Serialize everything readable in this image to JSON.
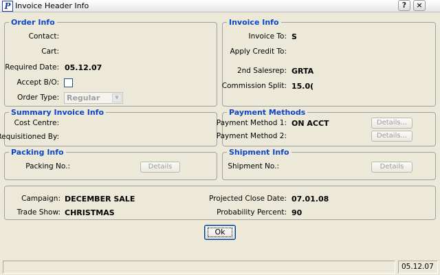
{
  "window": {
    "title": "Invoice Header Info",
    "icon_letter": "P",
    "help_glyph": "?",
    "close_glyph": "×"
  },
  "order_info": {
    "legend": "Order Info",
    "contact_label": "Contact:",
    "contact_value": "",
    "cart_label": "Cart:",
    "cart_value": "",
    "required_date_label": "Required Date:",
    "required_date_value": "05.12.07",
    "accept_bo_label": "Accept B/O:",
    "accept_bo_checked": false,
    "order_type_label": "Order Type:",
    "order_type_value": "Regular"
  },
  "invoice_info": {
    "legend": "Invoice Info",
    "invoice_to_label": "Invoice To:",
    "invoice_to_value": "S",
    "apply_credit_label": "Apply Credit To:",
    "apply_credit_value": "",
    "salesrep2_label": "2nd Salesrep:",
    "salesrep2_value": "GRTA",
    "commission_label": "Commission Split:",
    "commission_value": "15.0("
  },
  "summary_invoice_info": {
    "legend": "Summary Invoice Info",
    "cost_centre_label": "Cost Centre:",
    "requisitioned_label": "Requisitioned By:"
  },
  "payment_methods": {
    "legend": "Payment Methods",
    "method1_label": "Payment Method 1:",
    "method1_value": "ON ACCT",
    "method2_label": "Payment Method 2:",
    "method2_value": "",
    "details1_label": "Details...",
    "details2_label": "Details..."
  },
  "packing_info": {
    "legend": "Packing Info",
    "packing_no_label": "Packing No.:",
    "details_label": "Details"
  },
  "shipment_info": {
    "legend": "Shipment Info",
    "shipment_no_label": "Shipment No.:",
    "details_label": "Details"
  },
  "campaign_box": {
    "campaign_label": "Campaign:",
    "campaign_value": "DECEMBER SALE",
    "trade_show_label": "Trade Show:",
    "trade_show_value": "CHRISTMAS",
    "close_date_label": "Projected Close Date:",
    "close_date_value": "07.01.08",
    "probability_label": "Probability Percent:",
    "probability_value": "90"
  },
  "ok_button": {
    "label": "Ok"
  },
  "statusbar": {
    "message": "",
    "date": "05.12.07"
  }
}
